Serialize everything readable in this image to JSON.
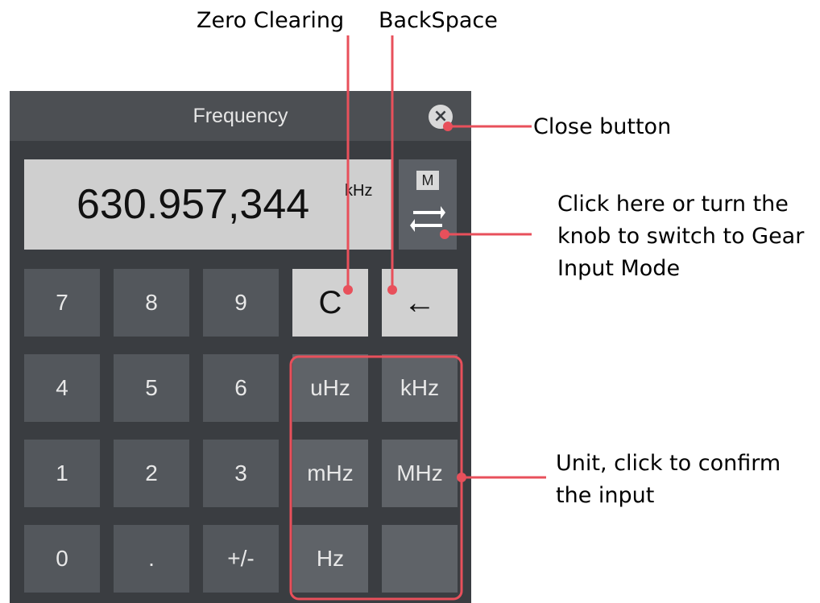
{
  "callouts": {
    "zero_clearing": "Zero Clearing",
    "backspace": "BackSpace",
    "close_button": "Close button",
    "gear_mode": "Click here or turn the knob to switch to Gear Input Mode",
    "unit": "Unit, click to confirm the input"
  },
  "dialog": {
    "title": "Frequency",
    "close_glyph": "×",
    "display_value": "630.957,344",
    "display_unit": "kHz",
    "mode_badge": "M"
  },
  "keypad": {
    "digits": [
      "7",
      "8",
      "9",
      "4",
      "5",
      "6",
      "1",
      "2",
      "3",
      "0",
      ".",
      "+/-"
    ],
    "clear": "C",
    "backspace": "←",
    "units": [
      "uHz",
      "kHz",
      "mHz",
      "MHz",
      "Hz"
    ]
  },
  "colors": {
    "panel": "#3a3d41",
    "annotation_red": "#e8505b",
    "display_bg": "#cfcfcf"
  },
  "icons": {
    "close": "close-icon",
    "swap": "swap-arrows-icon"
  }
}
